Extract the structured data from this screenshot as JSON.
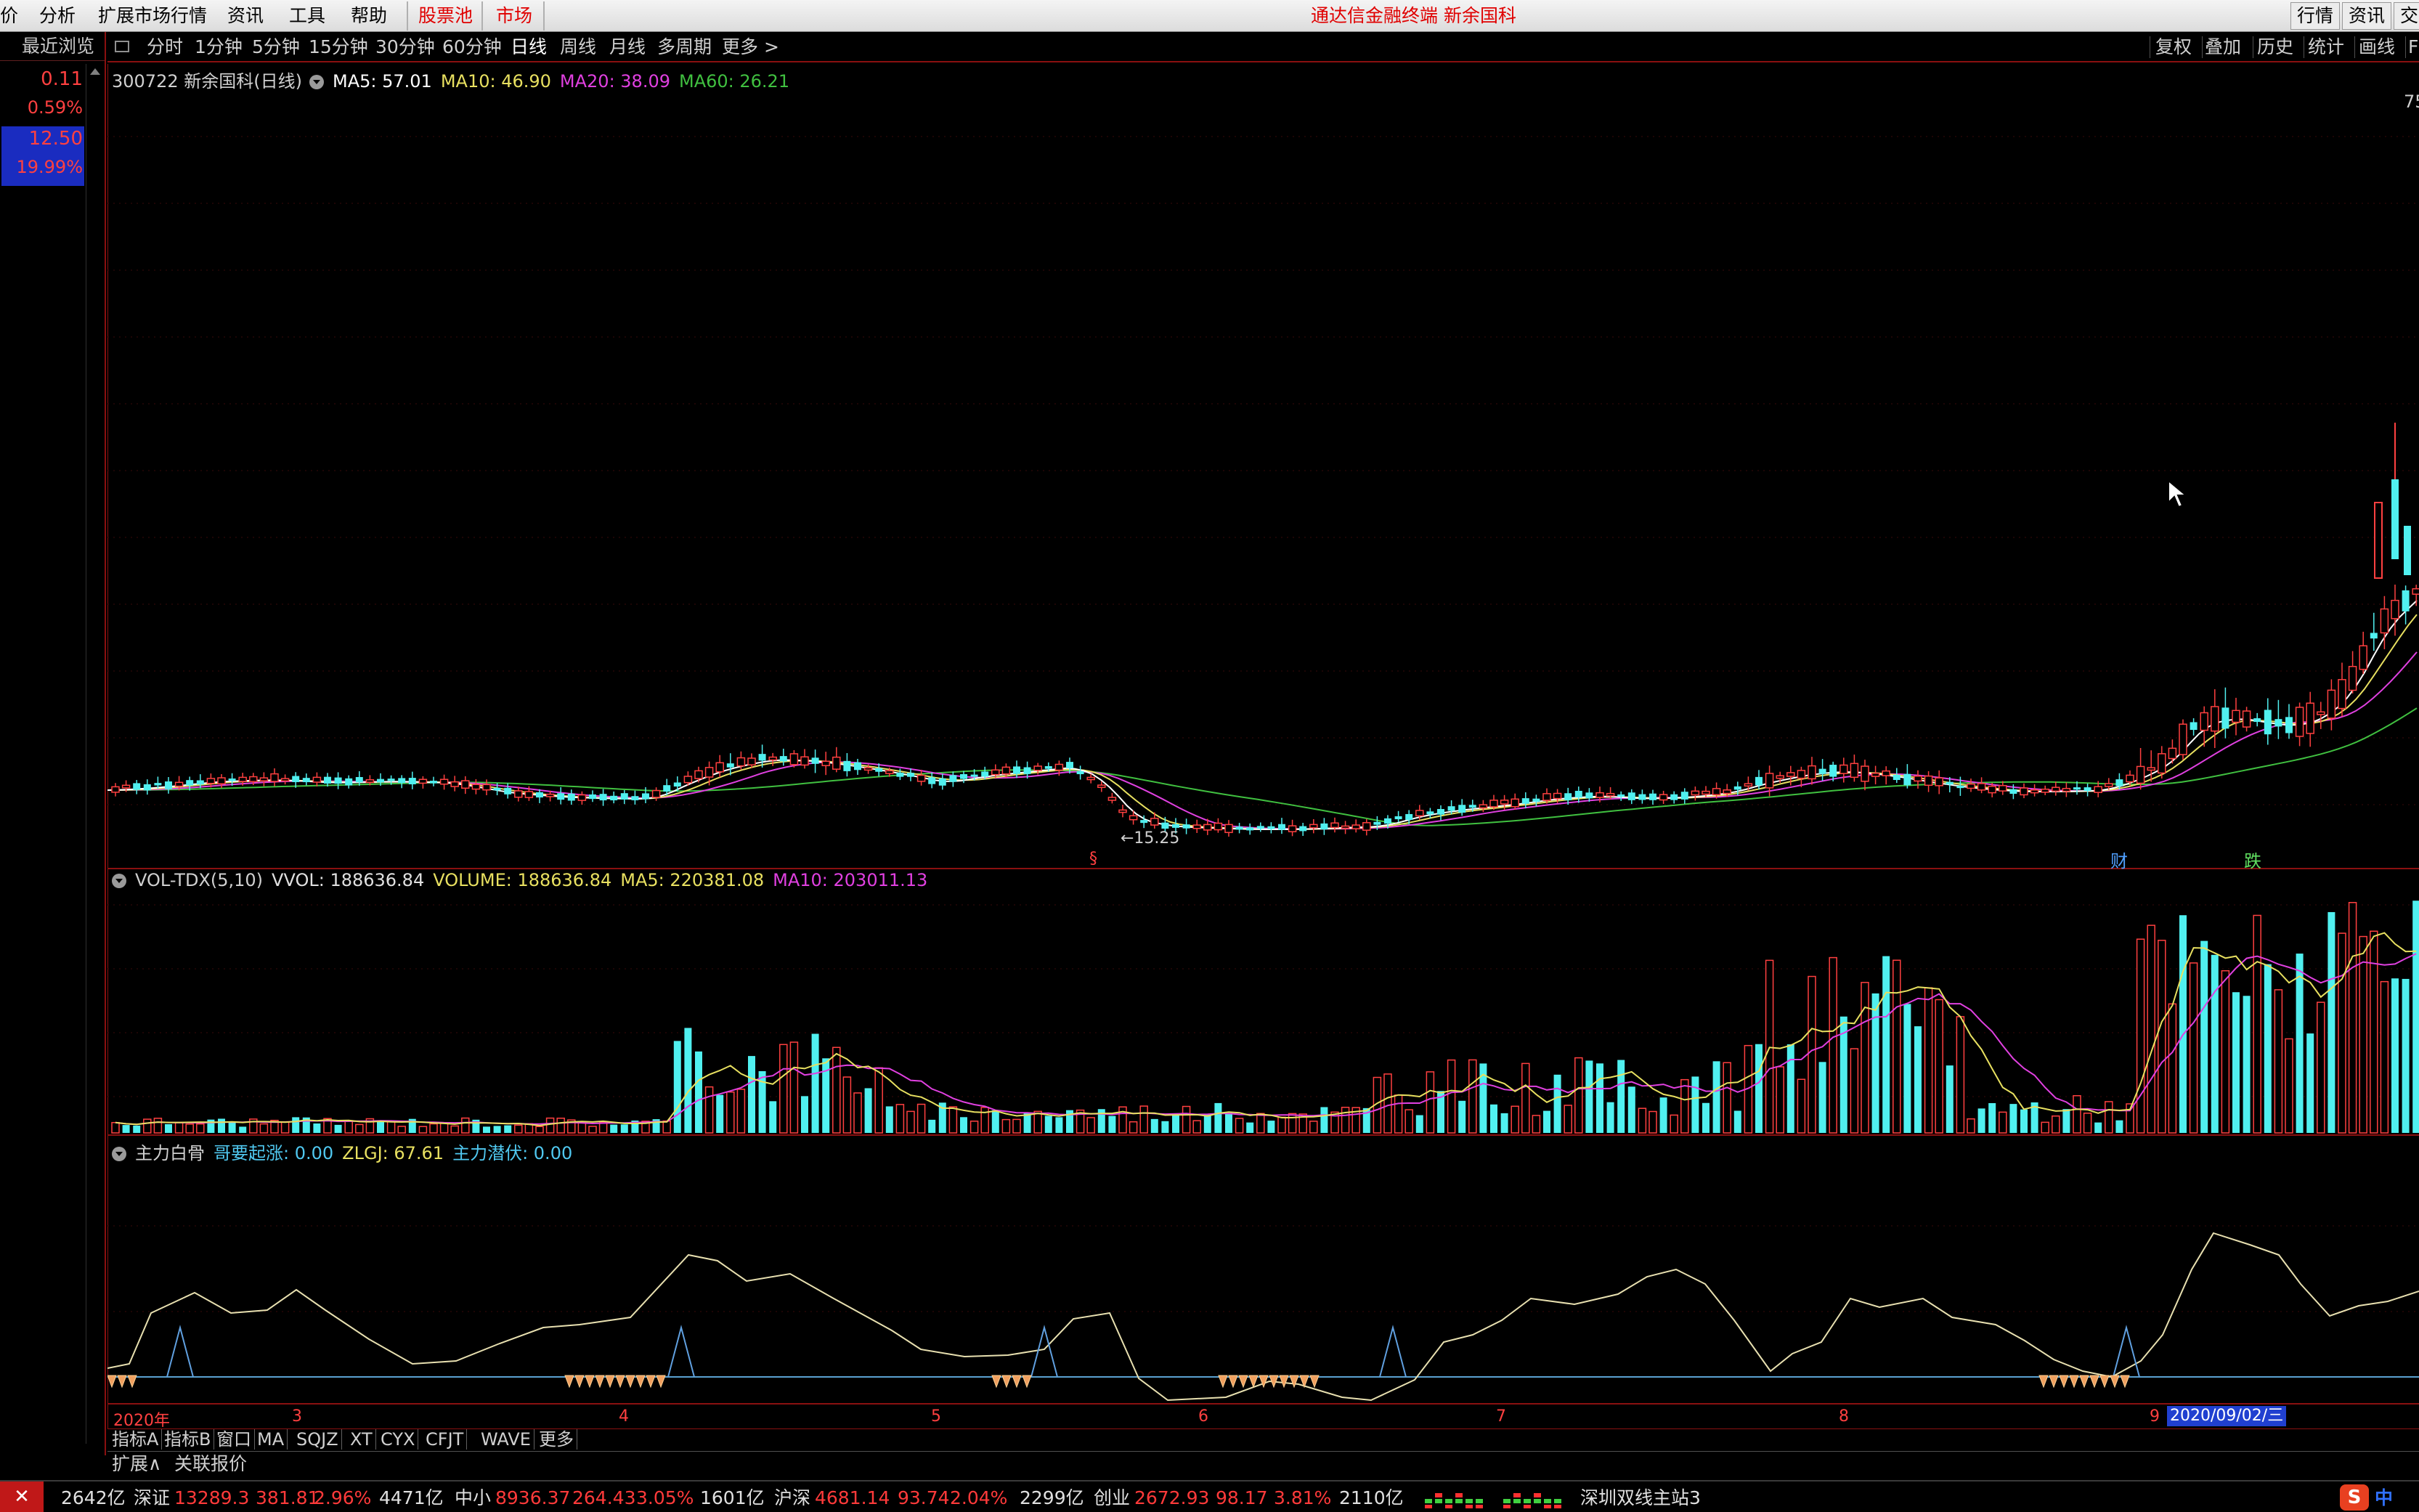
{
  "menu": {
    "items": [
      "价",
      "分析",
      "扩展市场行情",
      "资讯",
      "工具",
      "帮助"
    ],
    "stock_pool": "股票池",
    "market": "市场",
    "title": "通达信金融终端  新余国科",
    "right_buttons": [
      "行情",
      "资讯",
      "交"
    ]
  },
  "left_panel": {
    "header": "最近浏览",
    "values": [
      "0.11",
      "0.59%",
      "12.50",
      "19.99%"
    ]
  },
  "toolbar": {
    "periods": [
      "分时",
      "1分钟",
      "5分钟",
      "15分钟",
      "30分钟",
      "60分钟",
      "日线",
      "周线",
      "月线",
      "多周期",
      "更多 >"
    ],
    "active": "日线",
    "right": [
      "复权",
      "叠加",
      "历史",
      "统计",
      "画线",
      "F"
    ]
  },
  "main_chart": {
    "stock_title": "300722 新余国科(日线)",
    "ma5": "MA5: 57.01",
    "ma10": "MA10: 46.90",
    "ma20": "MA20: 38.09",
    "ma60": "MA60: 26.21",
    "axis_label_right": "75",
    "low_label": "←15.25",
    "event_markers": [
      "财",
      "跌"
    ],
    "event_marker_left": "§",
    "colors": {
      "ma5": "#ffffff",
      "ma10": "#e8e060",
      "ma20": "#e040e0",
      "ma60": "#40c040",
      "up": "#ff4040",
      "down": "#50f0f0"
    }
  },
  "volume_pane": {
    "name": "VOL-TDX(5,10)",
    "vvol": "VVOL: 188636.84",
    "volume": "VOLUME: 188636.84",
    "ma5": "MA5: 220381.08",
    "ma10": "MA10: 203011.13"
  },
  "indicator_pane": {
    "name": "主力白骨",
    "p1": "哥要起涨: 0.00",
    "p2": "ZLGJ: 67.61",
    "p3": "主力潜伏: 0.00"
  },
  "date_axis": {
    "labels": [
      "2020年",
      "3",
      "4",
      "5",
      "6",
      "7",
      "8",
      "9"
    ],
    "cursor_date": "2020/09/02/三"
  },
  "bottom_tabs": [
    "指标A",
    "指标B",
    "窗口",
    "MA",
    "SQJZ",
    "XT",
    "CYX",
    "CFJT",
    "WAVE",
    "更多"
  ],
  "expand_row": [
    "扩展∧",
    "关联报价"
  ],
  "status_bar": {
    "left_amount": "2642亿",
    "indices": [
      {
        "name": "深证",
        "value": "13289.3",
        "change": "381.81",
        "pct": "2.96%",
        "amount": "4471亿"
      },
      {
        "name": "中小",
        "value": "8936.37",
        "change": "264.43",
        "pct": "3.05%",
        "amount": "1601亿"
      },
      {
        "name": "沪深",
        "value": "4681.14",
        "change": "93.74",
        "pct": "2.04%",
        "amount": "2299亿"
      },
      {
        "name": "创业",
        "value": "2672.93",
        "change": "98.17",
        "pct": "3.81%",
        "amount": "2110亿"
      }
    ],
    "server": "深圳双线主站3",
    "ime": "中"
  }
}
